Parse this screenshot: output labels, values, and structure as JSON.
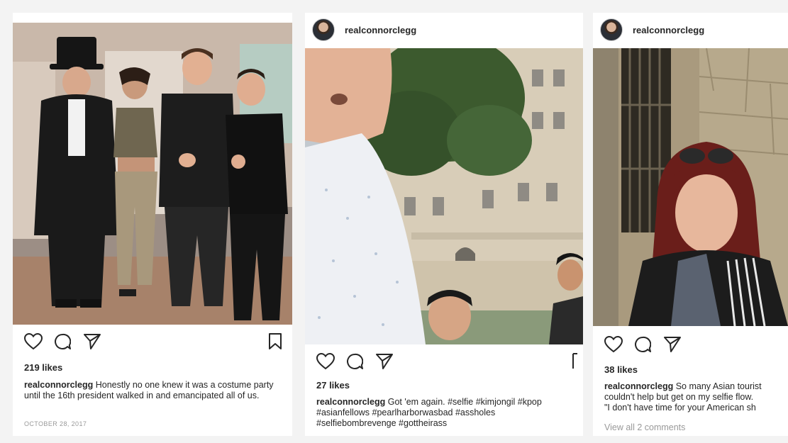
{
  "posts": [
    {
      "likes": "219 likes",
      "caption_user": "realconnorclegg",
      "caption_text": " Honestly no one knew it was a costume party until the 16th president walked in and emancipated all of us.",
      "date": "OCTOBER 28, 2017"
    },
    {
      "username": "realconnorclegg",
      "likes": "27 likes",
      "caption_user": "realconnorclegg",
      "caption_text": " Got 'em again. #selfie #kimjongil #kpop #asianfellows #pearlharborwasbad #assholes #selfiebombrevenge #gottheirass"
    },
    {
      "username": "realconnorclegg",
      "likes": "38 likes",
      "caption_user": "realconnorclegg",
      "caption_line1": " So many Asian tourist",
      "caption_line2": "couldn't help but get on my selfie flow.",
      "caption_line3": "\"I don't have time for your American sh",
      "comments_link": "View all 2 comments"
    }
  ],
  "icons": {
    "like": "heart-icon",
    "comment": "comment-icon",
    "share": "paper-plane-icon",
    "save": "bookmark-icon"
  }
}
